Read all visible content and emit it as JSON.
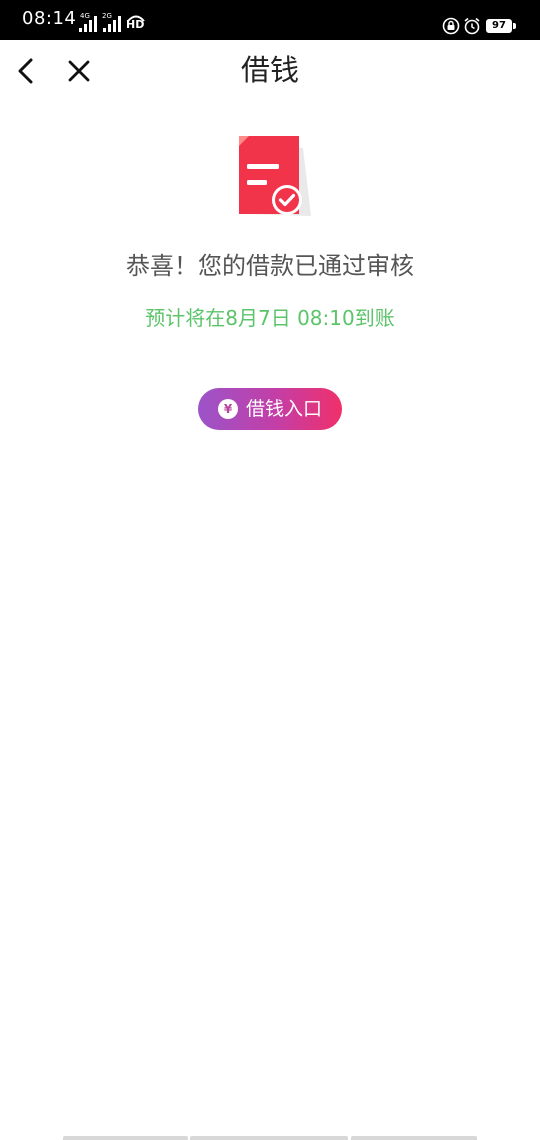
{
  "status_bar": {
    "time": "08:14",
    "sim1_tag": "4G",
    "sim2_tag": "2G",
    "hd_badge": "HD",
    "battery_level": "97"
  },
  "nav": {
    "title": "借钱",
    "back_icon": "chevron-left-icon",
    "close_icon": "close-icon"
  },
  "result": {
    "headline": "恭喜！您的借款已通过审核",
    "eta": "预计将在8月7日 08:10到账"
  },
  "entry_button": {
    "icon_glyph": "¥",
    "label": "借钱入口"
  },
  "colors": {
    "accent_green": "#5cc46a",
    "button_gradient_start": "#9b54c9",
    "button_gradient_end": "#f0306a",
    "doc_red": "#f2344a"
  }
}
